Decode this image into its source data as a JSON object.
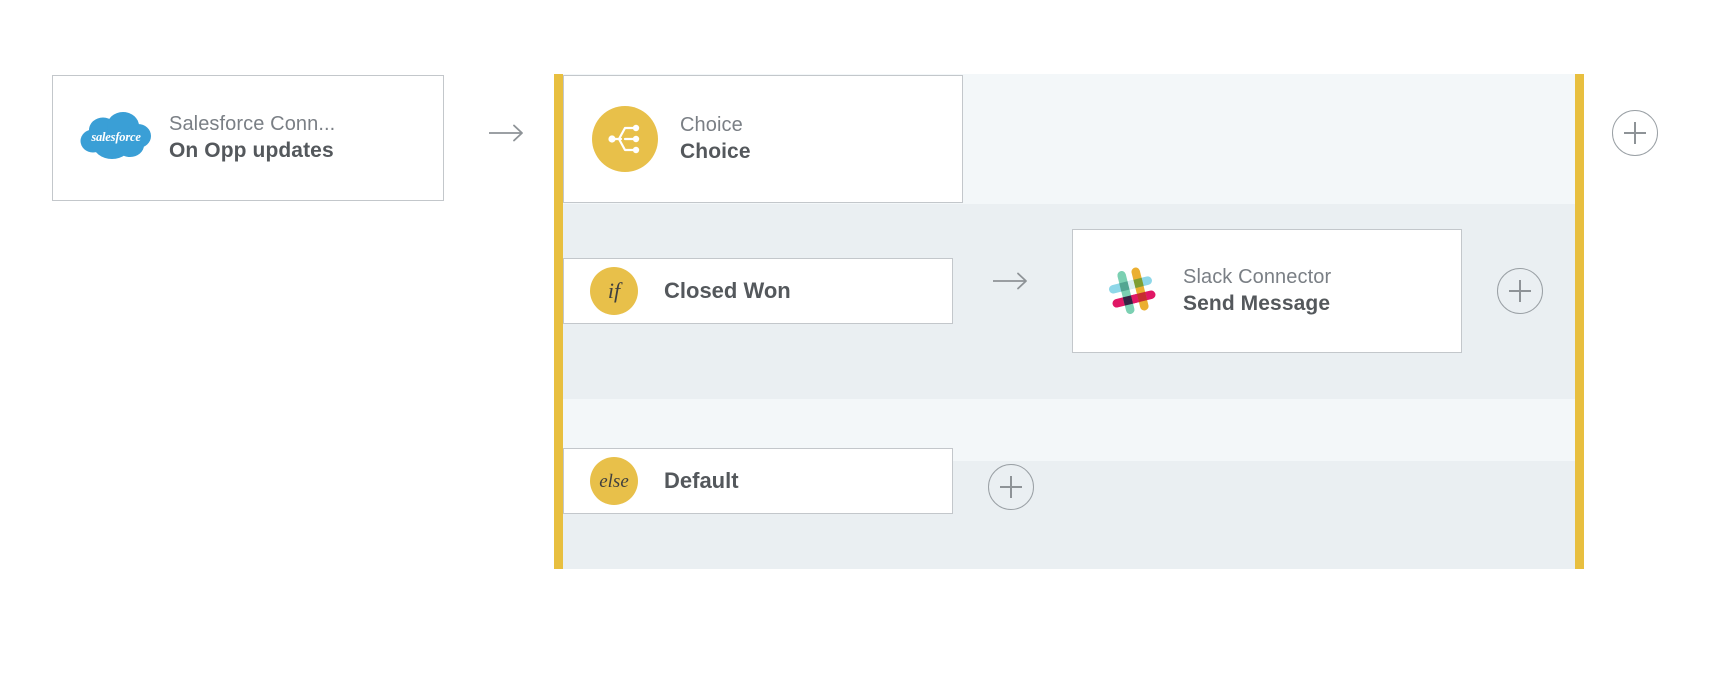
{
  "canvas": {
    "background": "#ffffff",
    "accent_yellow": "#e8bf3f",
    "band_light": "#f3f7f9",
    "band_dark": "#eaeff2",
    "card_border": "#c3c7cb",
    "text_primary": "#54585c",
    "text_secondary": "#7a7f85",
    "icon_gray": "#8e9397"
  },
  "trigger": {
    "icon": "salesforce-cloud-icon",
    "connector_label": "Salesforce Conn...",
    "operation_label": "On Opp updates"
  },
  "choice": {
    "icon": "choice-branch-icon",
    "connector_label": "Choice",
    "operation_label": "Choice",
    "branches": [
      {
        "badge": "if",
        "badge_icon": "if-badge-icon",
        "title": "Closed Won",
        "step": {
          "icon": "slack-logo-icon",
          "connector_label": "Slack Connector",
          "operation_label": "Send Message"
        }
      },
      {
        "badge": "else",
        "badge_icon": "else-badge-icon",
        "title": "Default",
        "step": null
      }
    ]
  },
  "arrows": {
    "trigger_to_choice": "arrow-right-icon",
    "if_to_slack": "arrow-right-icon",
    "glyph": "→"
  },
  "add_buttons": {
    "after_scope": "plus-icon",
    "after_slack": "plus-icon",
    "after_else": "plus-icon"
  },
  "slack_logo_colors": {
    "green": "#6ecadc",
    "bar_green": "#70ccab",
    "bar_blue": "#8ed7e8",
    "bar_yellow": "#e9a820",
    "bar_pink": "#e01765"
  }
}
